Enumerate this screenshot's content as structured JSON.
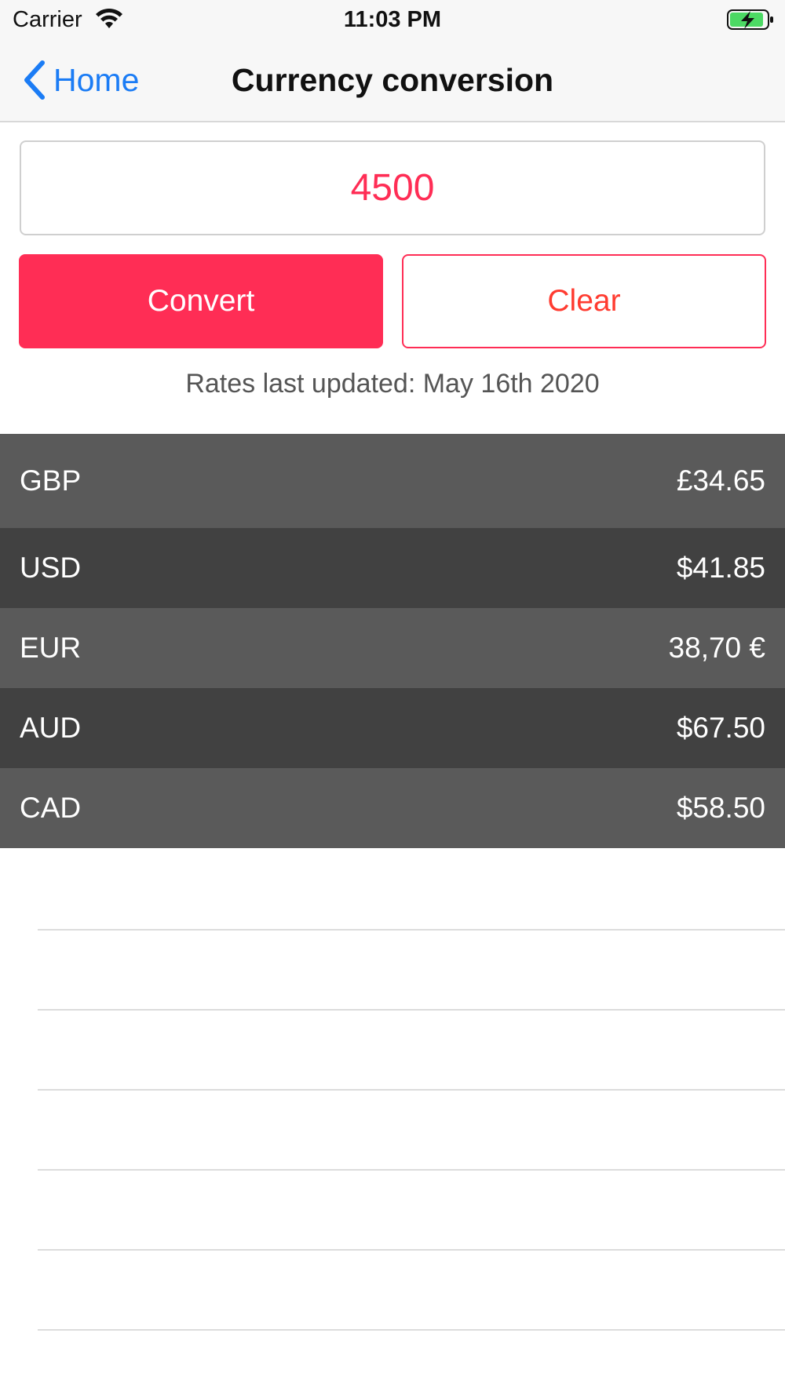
{
  "status_bar": {
    "carrier": "Carrier",
    "time": "11:03 PM",
    "wifi_icon": "wifi-icon",
    "battery_icon": "battery-charging-icon",
    "battery_color": "#4cd964"
  },
  "nav": {
    "back_label": "Home",
    "title": "Currency conversion",
    "accent": "#1b7cf5"
  },
  "amount_input": {
    "value": "4500",
    "color": "#ff2d55"
  },
  "actions": {
    "convert_label": "Convert",
    "clear_label": "Clear"
  },
  "rates_updated": "Rates last updated: May 16th 2020",
  "rates": [
    {
      "currency": "GBP",
      "value": "£34.65"
    },
    {
      "currency": "USD",
      "value": "$41.85"
    },
    {
      "currency": "EUR",
      "value": "38,70 €"
    },
    {
      "currency": "AUD",
      "value": "$67.50"
    },
    {
      "currency": "CAD",
      "value": "$58.50"
    }
  ]
}
